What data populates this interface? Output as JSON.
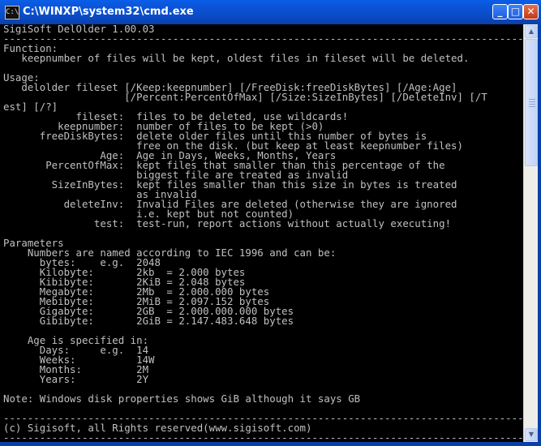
{
  "window": {
    "title": "C:\\WINXP\\system32\\cmd.exe",
    "icon_label": "C:\\",
    "minimize": "_",
    "maximize": "□",
    "close": "✕"
  },
  "console": {
    "lines": [
      "SigiSoft DelOlder 1.00.03",
      "-----------------------------------------------------------------------------------------------------------------",
      "Function:",
      "   keepnumber of files will be kept, oldest files in fileset will be deleted.",
      "",
      "Usage:",
      "   delolder fileset [/Keep:keepnumber] [/FreeDisk:freeDiskBytes] [/Age:Age]",
      "                    [/Percent:PercentOfMax] [/Size:SizeInBytes] [/DeleteInv] [/T",
      "est] [/?]",
      "            fileset:  files to be deleted, use wildcards!",
      "         keepnumber:  number of files to be kept (>0)",
      "      freeDiskBytes:  delete older files until this number of bytes is",
      "                      free on the disk. (but keep at least keepnumber files)",
      "                Age:  Age in Days, Weeks, Months, Years",
      "       PercentOfMax:  kept files that smaller than this percentage of the",
      "                      biggest file are treated as invalid",
      "        SizeInBytes:  kept files smaller than this size in bytes is treated",
      "                      as invalid",
      "          deleteInv:  Invalid Files are deleted (otherwise they are ignored",
      "                      i.e. kept but not counted)",
      "               test:  test-run, report actions without actually executing!",
      "",
      "Parameters",
      "    Numbers are named according to IEC 1996 and can be:",
      "      bytes:    e.g.  2048",
      "      Kilobyte:       2kb  = 2.000 bytes",
      "      Kibibyte:       2KiB = 2.048 bytes",
      "      Megabyte:       2Mb  = 2.000.000 bytes",
      "      Mebibyte:       2MiB = 2.097.152 bytes",
      "      Gigabyte:       2GB  = 2.000.000.000 bytes",
      "      Gibibyte:       2GiB = 2.147.483.648 bytes",
      "",
      "    Age is specified in:",
      "      Days:     e.g.  14",
      "      Weeks:          14W",
      "      Months:         2M",
      "      Years:          2Y",
      "",
      "Note: Windows disk properties shows GiB although it says GB",
      "",
      "-----------------------------------------------------------------------------------------------------------------",
      "(c) Sigisoft, all Rights reserved(www.sigisoft.com)",
      "-----------------------------------------------------------------------------------------------------------------"
    ]
  },
  "scrollbar": {
    "up_arrow": "▲",
    "down_arrow": "▼",
    "position_fraction": 0.0
  }
}
